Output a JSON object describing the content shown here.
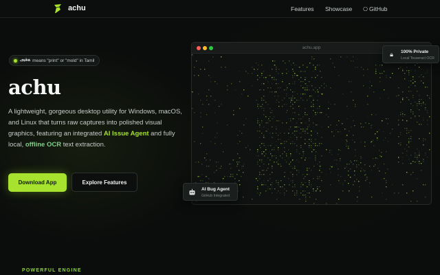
{
  "nav": {
    "brand": "achu",
    "links": [
      {
        "label": "Features"
      },
      {
        "label": "Showcase"
      },
      {
        "label": "GitHub",
        "icon": "github-icon"
      }
    ]
  },
  "badge": {
    "tamil": "அச்சு",
    "text": "means \"print\" or \"mold\" in Tamil"
  },
  "hero": {
    "title": "achu",
    "desc_part1": "A lightweight, gorgeous desktop utility for Windows, macOS, and Linux that turns raw captures into polished visual graphics, featuring an integrated ",
    "highlight1": "AI Issue Agent",
    "desc_part2": " and fully local, ",
    "highlight2": "offline OCR",
    "desc_part3": " text extraction."
  },
  "buttons": {
    "primary": "Download App",
    "secondary": "Explore Features"
  },
  "window": {
    "title": "achu.app"
  },
  "cards": {
    "private": {
      "title": "100% Private",
      "sub": "Local Tesseract OCR",
      "icon": "lock-icon"
    },
    "bug": {
      "title": "AI Bug Agent",
      "sub": "GitHub Integrated",
      "icon": "robot-icon"
    }
  },
  "section": {
    "label": "POWERFUL ENGINE"
  },
  "colors": {
    "accent": "#a6e22e",
    "background": "#0b0d0c"
  }
}
